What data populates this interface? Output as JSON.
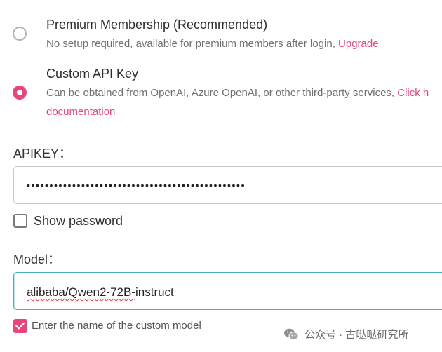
{
  "options": {
    "premium": {
      "title": "Premium Membership (Recommended)",
      "desc": "No setup required, available for premium members after login,",
      "link": "Upgrade",
      "selected": false
    },
    "custom": {
      "title": "Custom API Key",
      "desc": "Can be obtained from OpenAI, Azure OpenAI, or other third-party services,",
      "link": "Click h",
      "link2": "documentation",
      "selected": true
    }
  },
  "apikey": {
    "label": "APIKEY：",
    "value": "••••••••••••••••••••••••••••••••••••••••••••••••"
  },
  "show_password": {
    "label": "Show password",
    "checked": false
  },
  "model": {
    "label": "Model：",
    "value_part1": "alibaba/Qwen2-72B-",
    "value_part2": "instruct"
  },
  "custom_model": {
    "label": "Enter the name of the custom model",
    "checked": true
  },
  "watermark": {
    "text": "公众号 · 古哒哒研究所"
  },
  "colors": {
    "accent": "#e8457e",
    "focus_border": "#46b3b6"
  }
}
